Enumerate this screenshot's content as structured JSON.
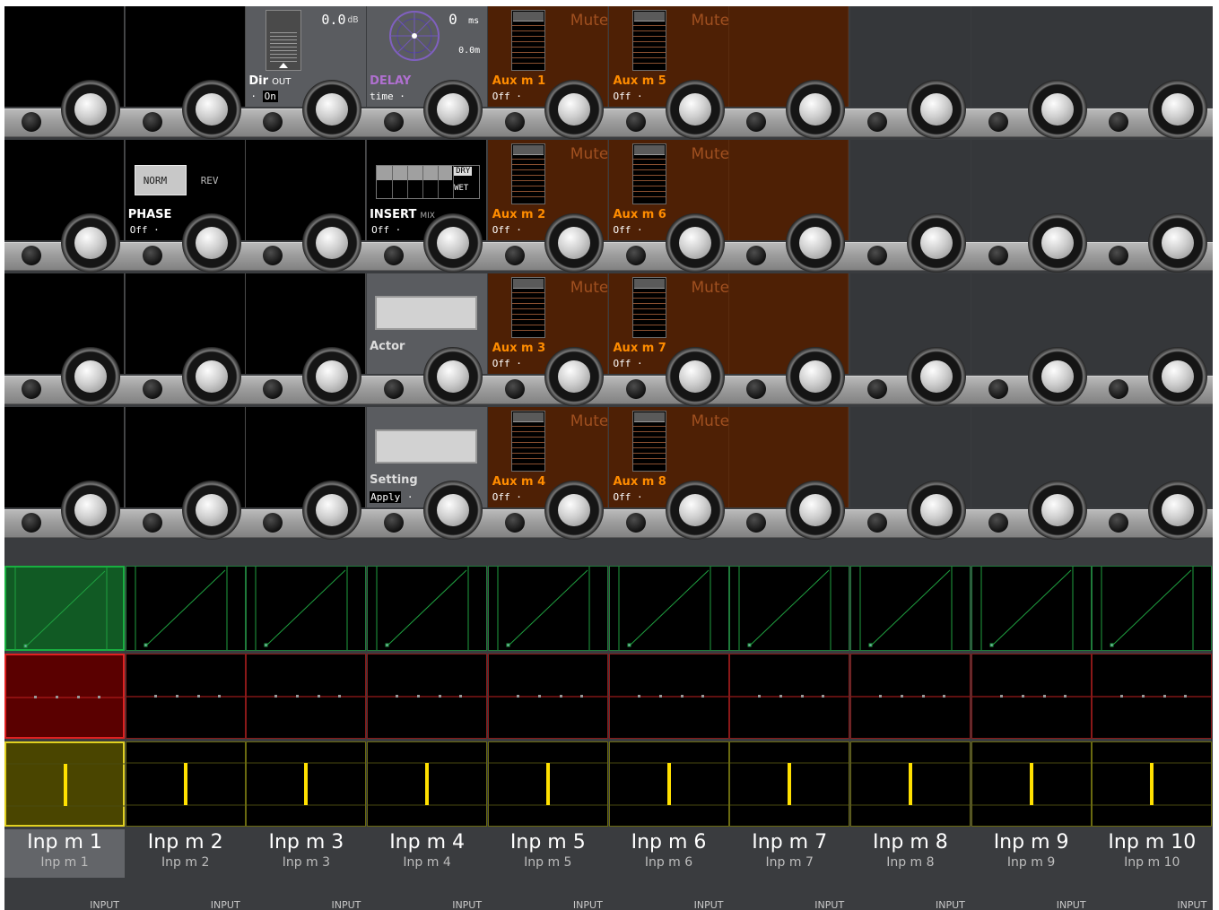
{
  "encoder_rows": [
    {
      "cells": [
        {
          "kind": "black"
        },
        {
          "kind": "black"
        },
        {
          "kind": "dir",
          "name": "Dir",
          "suffix": "OUT",
          "value": "On",
          "readout": "0.0",
          "unit": "dB"
        },
        {
          "kind": "delay",
          "name": "DELAY",
          "value": "time",
          "readout": "0",
          "unit": "ms",
          "distance": "0.0m"
        },
        {
          "kind": "aux",
          "name": "Aux m  1",
          "value": "Off",
          "mute": "Mute"
        },
        {
          "kind": "aux",
          "name": "Aux m  5",
          "value": "Off",
          "mute": "Mute"
        },
        {
          "kind": "brown"
        },
        {
          "kind": "dark"
        },
        {
          "kind": "dark"
        },
        {
          "kind": "dark"
        }
      ]
    },
    {
      "cells": [
        {
          "kind": "black"
        },
        {
          "kind": "phase",
          "name": "PHASE",
          "value": "Off",
          "option_a": "NORM",
          "option_b": "REV"
        },
        {
          "kind": "black"
        },
        {
          "kind": "insert",
          "name": "INSERT",
          "suffix": "MIX",
          "value": "Off",
          "label_dry": "DRY",
          "label_wet": "WET"
        },
        {
          "kind": "aux",
          "name": "Aux m  2",
          "value": "Off",
          "mute": "Mute"
        },
        {
          "kind": "aux",
          "name": "Aux m  6",
          "value": "Off",
          "mute": "Mute"
        },
        {
          "kind": "brown"
        },
        {
          "kind": "dark"
        },
        {
          "kind": "dark"
        },
        {
          "kind": "dark"
        }
      ]
    },
    {
      "cells": [
        {
          "kind": "black"
        },
        {
          "kind": "black"
        },
        {
          "kind": "black"
        },
        {
          "kind": "textbox",
          "name": "Actor",
          "value": ""
        },
        {
          "kind": "aux",
          "name": "Aux m  3",
          "value": "Off",
          "mute": "Mute"
        },
        {
          "kind": "aux",
          "name": "Aux m  7",
          "value": "Off",
          "mute": "Mute"
        },
        {
          "kind": "brown"
        },
        {
          "kind": "dark"
        },
        {
          "kind": "dark"
        },
        {
          "kind": "dark"
        }
      ]
    },
    {
      "cells": [
        {
          "kind": "black"
        },
        {
          "kind": "black"
        },
        {
          "kind": "black"
        },
        {
          "kind": "textbox",
          "name": "Setting",
          "value": "Apply"
        },
        {
          "kind": "aux",
          "name": "Aux m  4",
          "value": "Off",
          "mute": "Mute"
        },
        {
          "kind": "aux",
          "name": "Aux m  8",
          "value": "Off",
          "mute": "Mute"
        },
        {
          "kind": "brown"
        },
        {
          "kind": "dark"
        },
        {
          "kind": "dark"
        },
        {
          "kind": "dark"
        }
      ]
    }
  ],
  "channels": [
    {
      "name": "Inp m  1",
      "sub": "Inp m  1",
      "type": "INPUT",
      "selected": true
    },
    {
      "name": "Inp m  2",
      "sub": "Inp m  2",
      "type": "INPUT",
      "selected": false
    },
    {
      "name": "Inp m  3",
      "sub": "Inp m  3",
      "type": "INPUT",
      "selected": false
    },
    {
      "name": "Inp m  4",
      "sub": "Inp m  4",
      "type": "INPUT",
      "selected": false
    },
    {
      "name": "Inp m  5",
      "sub": "Inp m  5",
      "type": "INPUT",
      "selected": false
    },
    {
      "name": "Inp m  6",
      "sub": "Inp m  6",
      "type": "INPUT",
      "selected": false
    },
    {
      "name": "Inp m  7",
      "sub": "Inp m  7",
      "type": "INPUT",
      "selected": false
    },
    {
      "name": "Inp m  8",
      "sub": "Inp m  8",
      "type": "INPUT",
      "selected": false
    },
    {
      "name": "Inp m  9",
      "sub": "Inp m  9",
      "type": "INPUT",
      "selected": false
    },
    {
      "name": "Inp m 10",
      "sub": "Inp m 10",
      "type": "INPUT",
      "selected": false
    }
  ],
  "colors": {
    "aux_label": "#ff8c00",
    "delay_label": "#b070d0",
    "dynamics_line": "#1fa040",
    "eq_line": "#c02020",
    "pan_marker": "#ffe000"
  }
}
